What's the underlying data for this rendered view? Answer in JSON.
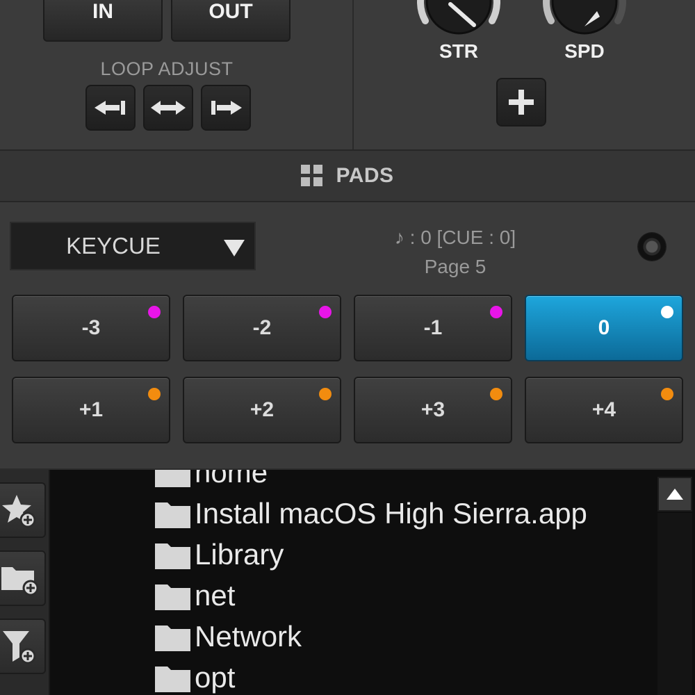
{
  "loop": {
    "in_label": "IN",
    "out_label": "OUT",
    "adjust_label": "LOOP ADJUST"
  },
  "knobs": [
    {
      "label": "STR"
    },
    {
      "label": "SPD"
    }
  ],
  "pads_header": {
    "title": "PADS"
  },
  "pads": {
    "mode": "KEYCUE",
    "info_line1": "♪ : 0  [CUE : 0]",
    "info_line2": "Page 5",
    "buttons": [
      {
        "label": "-3",
        "dot_color": "#e815e8",
        "active": false
      },
      {
        "label": "-2",
        "dot_color": "#e815e8",
        "active": false
      },
      {
        "label": "-1",
        "dot_color": "#e815e8",
        "active": false
      },
      {
        "label": "0",
        "dot_color": "#ffffff",
        "active": true
      },
      {
        "label": "+1",
        "dot_color": "#f28c0f",
        "active": false
      },
      {
        "label": "+2",
        "dot_color": "#f28c0f",
        "active": false
      },
      {
        "label": "+3",
        "dot_color": "#f28c0f",
        "active": false
      },
      {
        "label": "+4",
        "dot_color": "#f28c0f",
        "active": false
      }
    ],
    "active_color": "#1592c8"
  },
  "browser": {
    "folders": [
      {
        "name": "home"
      },
      {
        "name": "Install macOS High Sierra.app"
      },
      {
        "name": "Library"
      },
      {
        "name": "net"
      },
      {
        "name": "Network"
      },
      {
        "name": "opt"
      }
    ]
  }
}
